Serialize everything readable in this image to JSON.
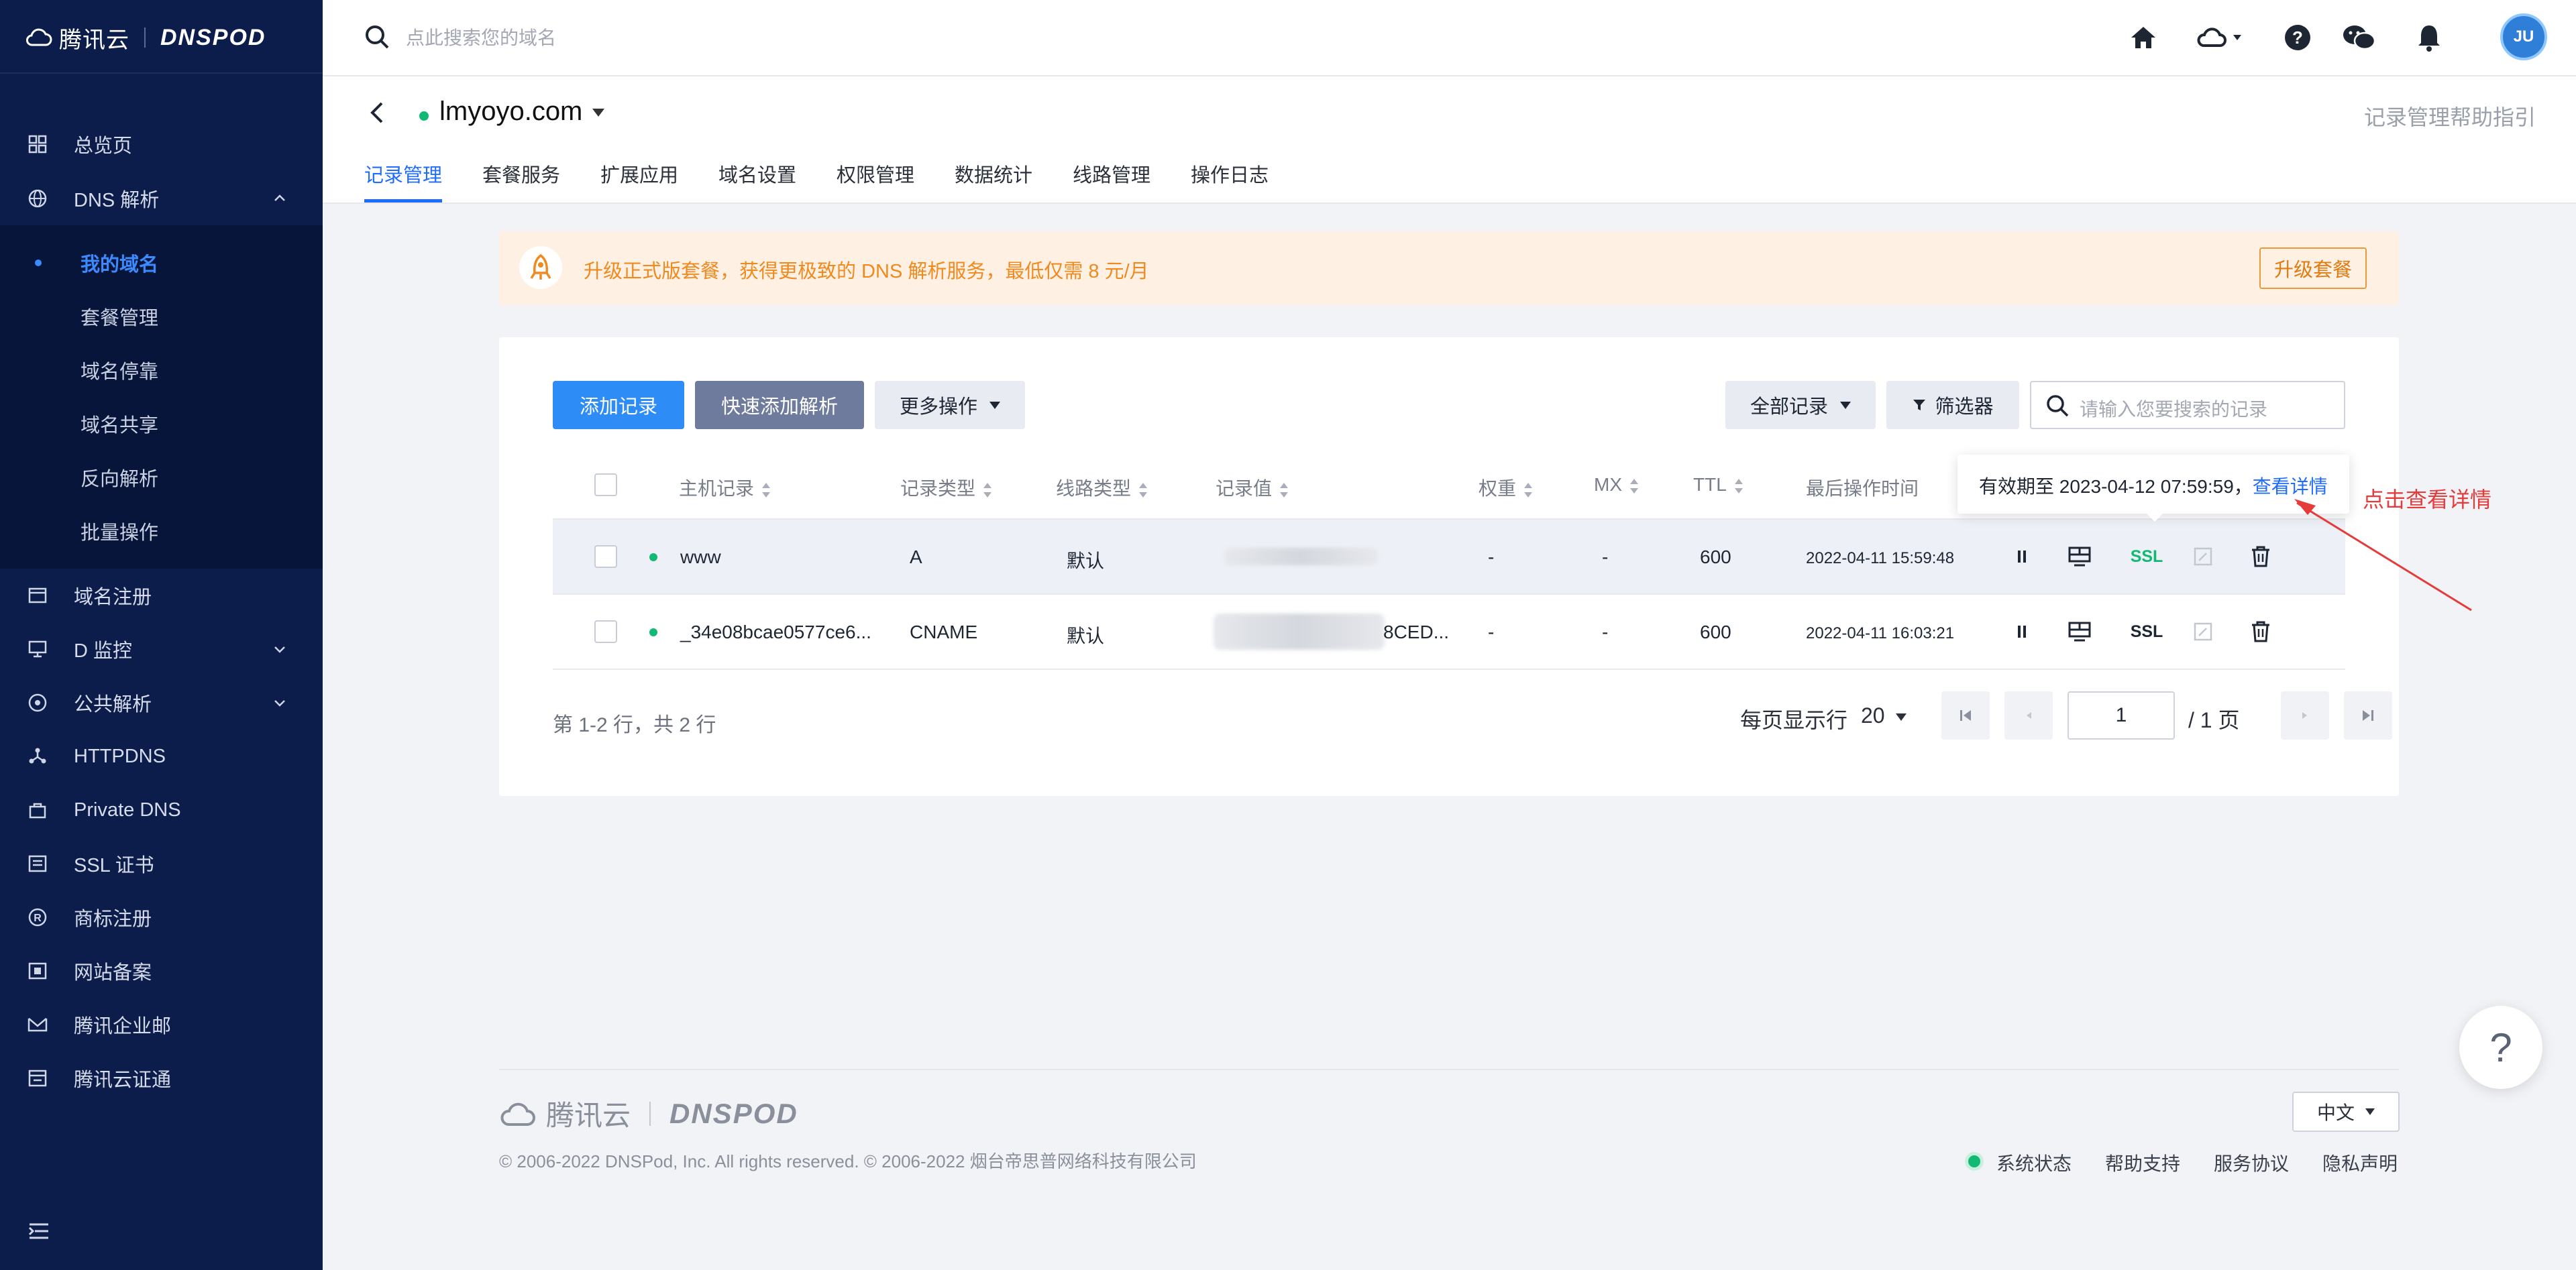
{
  "sidebar": {
    "brand": "腾讯云",
    "product": "DNSPOD",
    "items": [
      {
        "label": "总览页",
        "icon": "grid-icon"
      },
      {
        "label": "DNS 解析",
        "icon": "globe-icon"
      },
      {
        "label": "域名注册",
        "icon": "calendar-icon"
      },
      {
        "label": "D 监控",
        "icon": "monitor-icon"
      },
      {
        "label": "公共解析",
        "icon": "globe-network-icon"
      },
      {
        "label": "HTTPDNS",
        "icon": "nodes-icon"
      },
      {
        "label": "Private DNS",
        "icon": "lock-box-icon"
      },
      {
        "label": "SSL 证书",
        "icon": "certificate-icon"
      },
      {
        "label": "商标注册",
        "icon": "registered-icon"
      },
      {
        "label": "网站备案",
        "icon": "record-icon"
      },
      {
        "label": "腾讯企业邮",
        "icon": "mail-icon"
      },
      {
        "label": "腾讯云证通",
        "icon": "id-card-icon"
      }
    ],
    "subitems": [
      {
        "label": "我的域名",
        "active": true
      },
      {
        "label": "套餐管理"
      },
      {
        "label": "域名停靠"
      },
      {
        "label": "域名共享"
      },
      {
        "label": "反向解析"
      },
      {
        "label": "批量操作"
      }
    ]
  },
  "topbar": {
    "search_placeholder": "点此搜索您的域名",
    "avatar_text": "JU"
  },
  "domain": {
    "name": "lmyoyo.com",
    "help_link": "记录管理帮助指引",
    "tabs": [
      "记录管理",
      "套餐服务",
      "扩展应用",
      "域名设置",
      "权限管理",
      "数据统计",
      "线路管理",
      "操作日志"
    ],
    "active_tab": "记录管理"
  },
  "promo": {
    "text": "升级正式版套餐，获得更极致的 DNS 解析服务，最低仅需 8 元/月",
    "button": "升级套餐"
  },
  "toolbar": {
    "add_record": "添加记录",
    "quick_add": "快速添加解析",
    "more_ops": "更多操作",
    "all_records": "全部记录",
    "filter": "筛选器",
    "search_placeholder": "请输入您要搜索的记录"
  },
  "table": {
    "columns": [
      "主机记录",
      "记录类型",
      "线路类型",
      "记录值",
      "权重",
      "MX",
      "TTL",
      "最后操作时间"
    ],
    "rows": [
      {
        "host": "www",
        "type": "A",
        "line": "默认",
        "value_suffix": "",
        "weight": "-",
        "mx": "-",
        "ttl": "600",
        "time": "2022-04-11 15:59:48",
        "ssl_color": "#11b973"
      },
      {
        "host": "_34e08bcae0577ce6...",
        "type": "CNAME",
        "line": "默认",
        "value_suffix": "8CED...",
        "weight": "-",
        "mx": "-",
        "ttl": "600",
        "time": "2022-04-11 16:03:21",
        "ssl_color": "#1f2633"
      }
    ],
    "ssl_label": "SSL"
  },
  "tooltip": {
    "text": "有效期至 2023-04-12 07:59:59，",
    "link": "查看详情"
  },
  "annotation": "点击查看详情",
  "pagination": {
    "total_text": "第 1-2 行，共 2 行",
    "per_page_label": "每页显示行",
    "per_page": "20",
    "current_page": "1",
    "total_pages_text": "/ 1 页"
  },
  "footer": {
    "brand": "腾讯云",
    "product": "DNSPOD",
    "copyright": "© 2006-2022 DNSPod, Inc. All rights reserved. © 2006-2022 烟台帝思普网络科技有限公司",
    "language": "中文",
    "links": [
      "系统状态",
      "帮助支持",
      "服务协议",
      "隐私声明"
    ]
  },
  "help_float": "?",
  "colors": {
    "sidebar_bg": "#0c1d4b",
    "accent": "#1f6dff",
    "status_green": "#11b973",
    "promo_orange": "#f08a1e",
    "annotation_red": "#e53b3b"
  }
}
